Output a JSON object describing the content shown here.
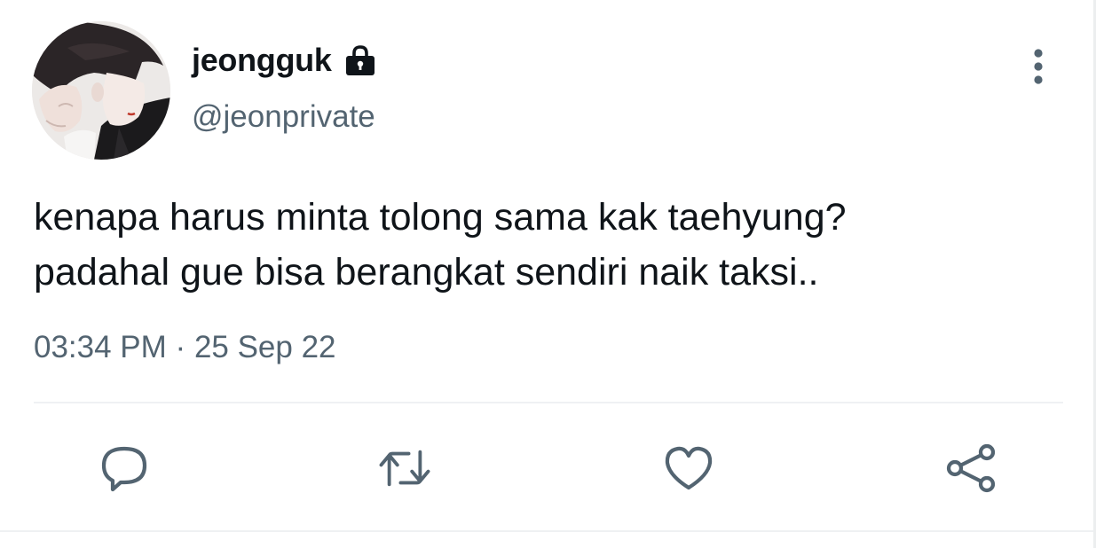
{
  "tweet": {
    "author": {
      "display_name": "jeongguk",
      "handle": "@jeonprivate",
      "protected_icon": "lock-icon",
      "avatar": "profile-photo"
    },
    "text_lines": [
      "kenapa harus minta tolong sama kak taehyung?",
      "padahal gue bisa berangkat sendiri naik taksi.."
    ],
    "time": "03:34 PM",
    "separator": "·",
    "date": "25 Sep 22",
    "more_icon": "more-vertical-icon",
    "actions": [
      {
        "name": "reply",
        "icon": "reply-bubble-icon"
      },
      {
        "name": "retweet",
        "icon": "retweet-icon"
      },
      {
        "name": "like",
        "icon": "heart-icon"
      },
      {
        "name": "share",
        "icon": "share-icon"
      }
    ]
  },
  "colors": {
    "text_primary": "#0f1419",
    "text_secondary": "#536471",
    "divider": "#eff1f3",
    "icon": "#536471"
  }
}
